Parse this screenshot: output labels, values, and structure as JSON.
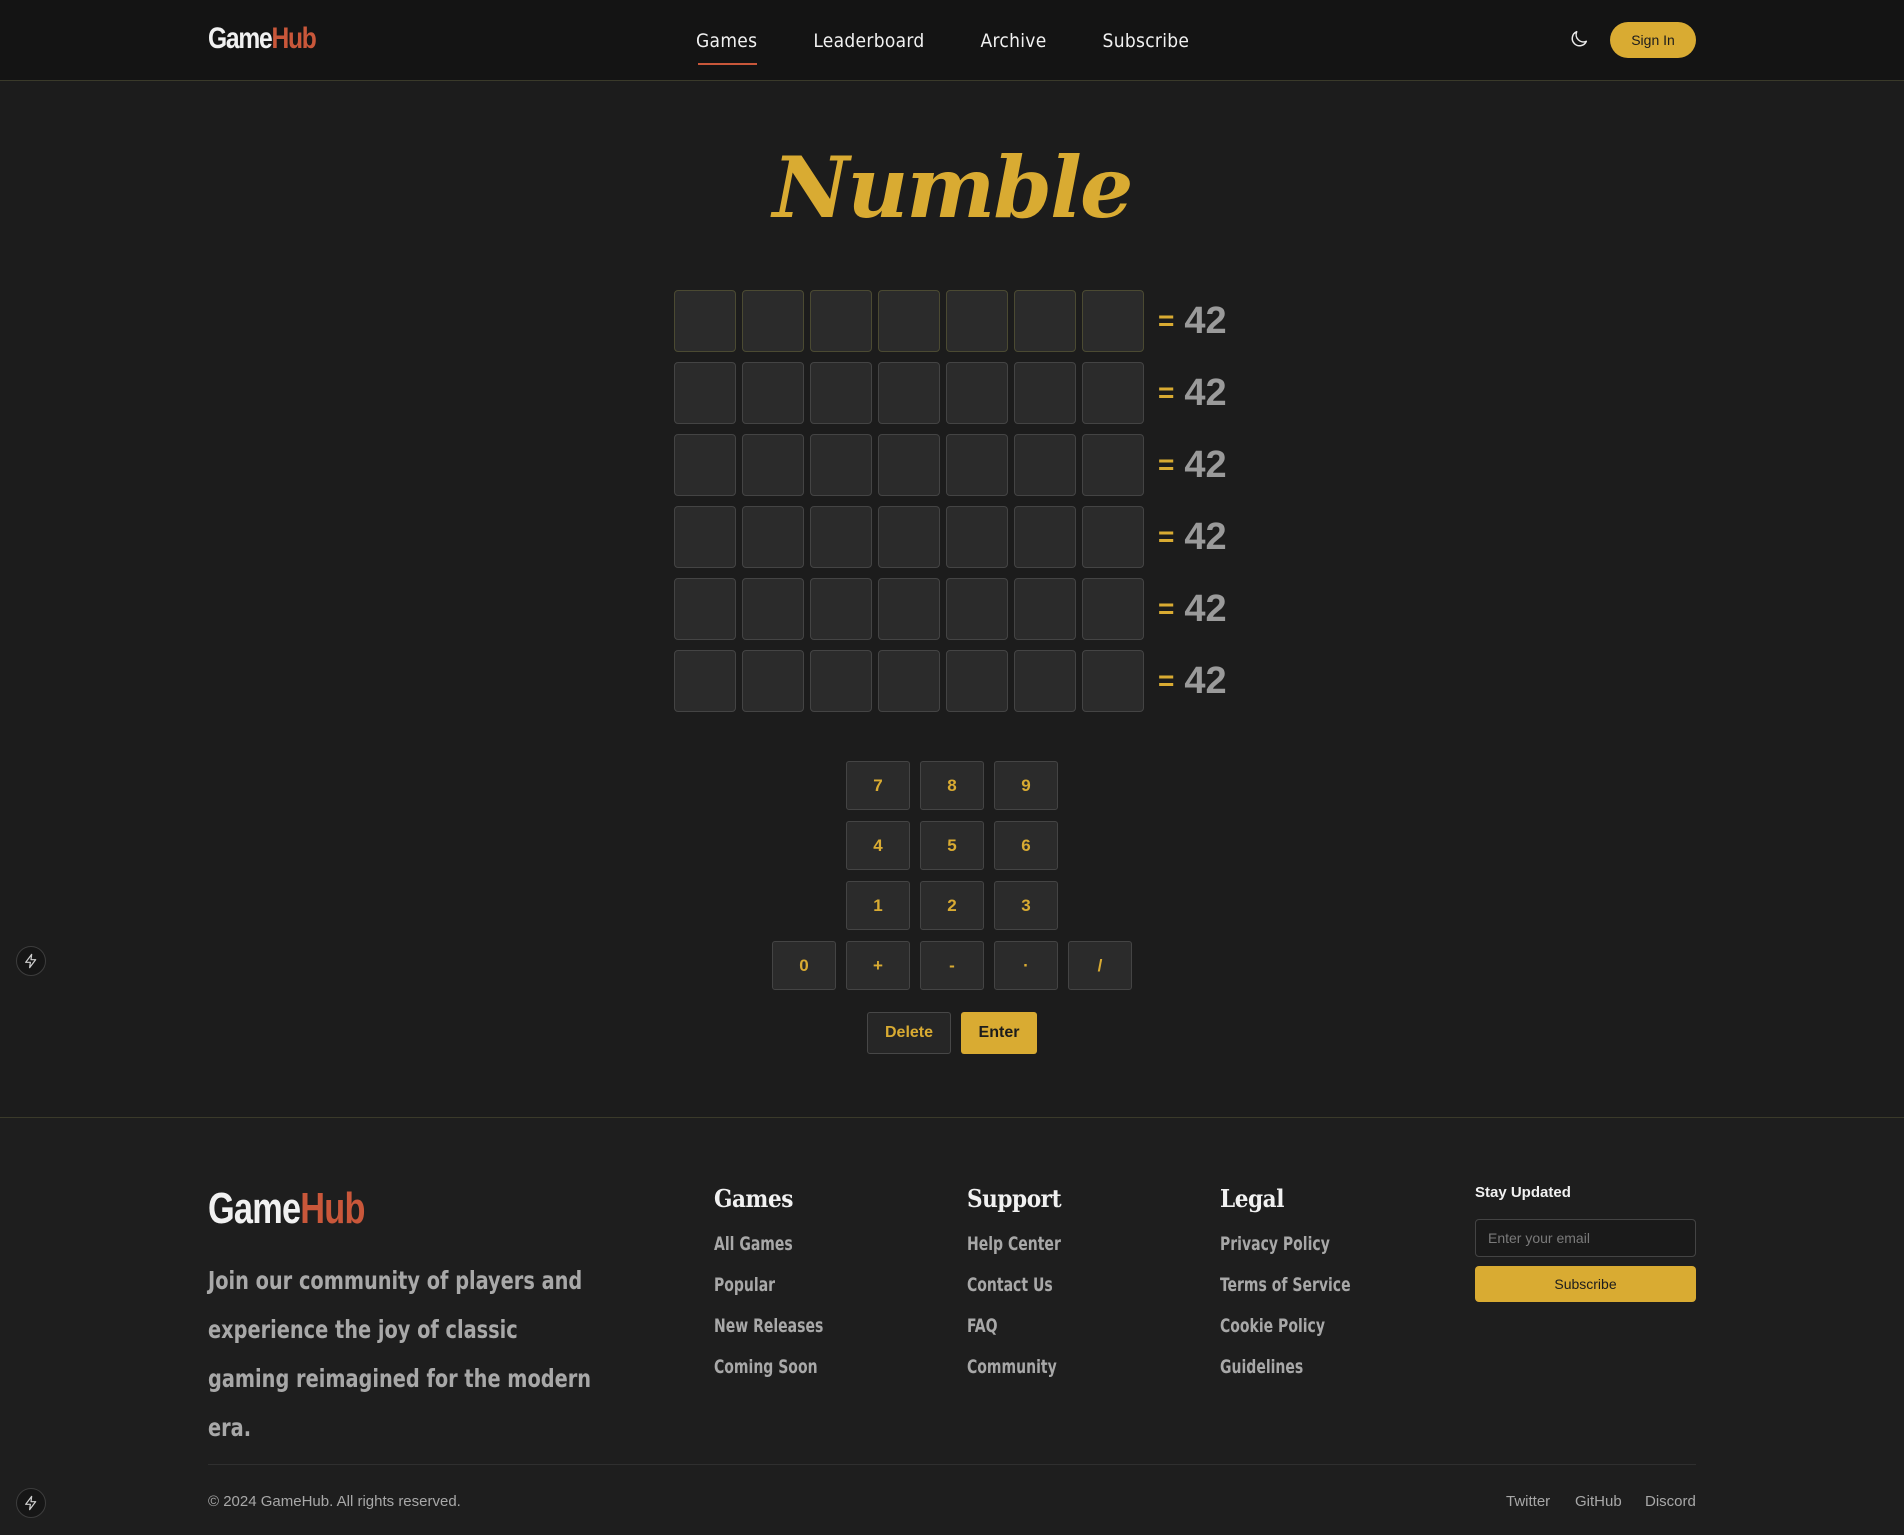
{
  "header": {
    "logo_part1": "Game",
    "logo_part2": "Hub",
    "nav": [
      {
        "label": "Games",
        "active": true
      },
      {
        "label": "Leaderboard",
        "active": false
      },
      {
        "label": "Archive",
        "active": false
      },
      {
        "label": "Subscribe",
        "active": false
      }
    ],
    "theme_icon": "moon-icon",
    "signin_label": "Sign In"
  },
  "game": {
    "title": "Numble",
    "equals": "=",
    "target": "42",
    "rows": 6,
    "columns": 7
  },
  "keypad": {
    "rows": [
      [
        "7",
        "8",
        "9"
      ],
      [
        "4",
        "5",
        "6"
      ],
      [
        "1",
        "2",
        "3"
      ],
      [
        "0",
        "+",
        "-",
        "·",
        "/"
      ]
    ],
    "delete_label": "Delete",
    "enter_label": "Enter"
  },
  "side_icon": "bolt-icon",
  "footer": {
    "logo_part1": "Game",
    "logo_part2": "Hub",
    "tagline": "Join our community of players and experience the joy of classic gaming reimagined for the modern era.",
    "columns": [
      {
        "title": "Games",
        "links": [
          "All Games",
          "Popular",
          "New Releases",
          "Coming Soon"
        ]
      },
      {
        "title": "Support",
        "links": [
          "Help Center",
          "Contact Us",
          "FAQ",
          "Community"
        ]
      },
      {
        "title": "Legal",
        "links": [
          "Privacy Policy",
          "Terms of Service",
          "Cookie Policy",
          "Guidelines"
        ]
      }
    ],
    "newsletter": {
      "title": "Stay Updated",
      "placeholder": "Enter your email",
      "button_label": "Subscribe"
    },
    "copyright": "© 2024 GameHub. All rights reserved.",
    "social": [
      "Twitter",
      "GitHub",
      "Discord"
    ]
  },
  "colors": {
    "accent": "#d9ab32",
    "brand_secondary": "#c9573a",
    "background": "#1c1c1c"
  }
}
